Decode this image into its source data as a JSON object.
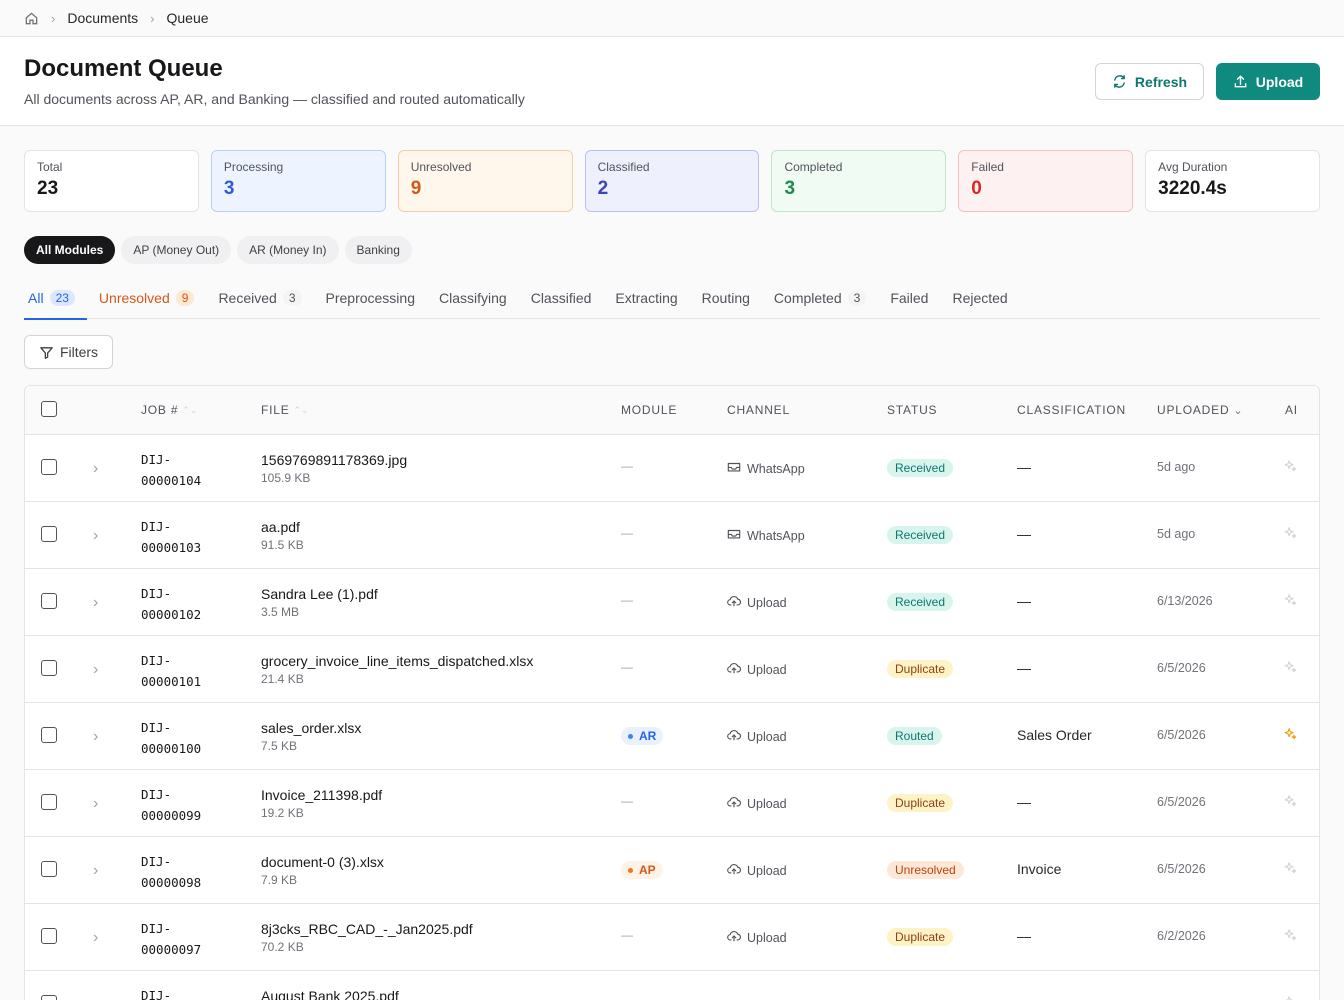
{
  "breadcrumb": {
    "home_icon": "home-icon",
    "items": [
      "Documents",
      "Queue"
    ]
  },
  "header": {
    "title": "Document Queue",
    "subtitle": "All documents across AP, AR, and Banking — classified and routed automatically",
    "refresh_label": "Refresh",
    "upload_label": "Upload"
  },
  "stats": [
    {
      "label": "Total",
      "value": "23"
    },
    {
      "label": "Processing",
      "value": "3"
    },
    {
      "label": "Unresolved",
      "value": "9"
    },
    {
      "label": "Classified",
      "value": "2"
    },
    {
      "label": "Completed",
      "value": "3"
    },
    {
      "label": "Failed",
      "value": "0"
    },
    {
      "label": "Avg Duration",
      "value": "3220.4s"
    }
  ],
  "modules": [
    "All Modules",
    "AP (Money Out)",
    "AR (Money In)",
    "Banking"
  ],
  "tabs": [
    {
      "label": "All",
      "count": "23"
    },
    {
      "label": "Unresolved",
      "count": "9"
    },
    {
      "label": "Received",
      "count": "3"
    },
    {
      "label": "Preprocessing"
    },
    {
      "label": "Classifying"
    },
    {
      "label": "Classified"
    },
    {
      "label": "Extracting"
    },
    {
      "label": "Routing"
    },
    {
      "label": "Completed",
      "count": "3"
    },
    {
      "label": "Failed"
    },
    {
      "label": "Rejected"
    }
  ],
  "filters_label": "Filters",
  "table": {
    "columns": {
      "job": "JOB #",
      "file": "FILE",
      "module": "MODULE",
      "channel": "CHANNEL",
      "status": "STATUS",
      "classification": "CLASSIFICATION",
      "uploaded": "UPLOADED",
      "ai": "AI"
    },
    "rows": [
      {
        "job1": "DIJ-",
        "job2": "00000104",
        "file": "1569769891178369.jpg",
        "size": "105.9 KB",
        "module": "—",
        "channel": "WhatsApp",
        "status": "Received",
        "classification": "—",
        "uploaded": "5d ago"
      },
      {
        "job1": "DIJ-",
        "job2": "00000103",
        "file": "aa.pdf",
        "size": "91.5 KB",
        "module": "—",
        "channel": "WhatsApp",
        "status": "Received",
        "classification": "—",
        "uploaded": "5d ago"
      },
      {
        "job1": "DIJ-",
        "job2": "00000102",
        "file": "Sandra Lee (1).pdf",
        "size": "3.5 MB",
        "module": "—",
        "channel": "Upload",
        "status": "Received",
        "classification": "—",
        "uploaded": "6/13/2026"
      },
      {
        "job1": "DIJ-",
        "job2": "00000101",
        "file": "grocery_invoice_line_items_dispatched.xlsx",
        "size": "21.4 KB",
        "module": "—",
        "channel": "Upload",
        "status": "Duplicate",
        "classification": "—",
        "uploaded": "6/5/2026"
      },
      {
        "job1": "DIJ-",
        "job2": "00000100",
        "file": "sales_order.xlsx",
        "size": "7.5 KB",
        "module": "AR",
        "channel": "Upload",
        "status": "Routed",
        "classification": "Sales Order",
        "uploaded": "6/5/2026"
      },
      {
        "job1": "DIJ-",
        "job2": "00000099",
        "file": "Invoice_211398.pdf",
        "size": "19.2 KB",
        "module": "—",
        "channel": "Upload",
        "status": "Duplicate",
        "classification": "—",
        "uploaded": "6/5/2026"
      },
      {
        "job1": "DIJ-",
        "job2": "00000098",
        "file": "document-0 (3).xlsx",
        "size": "7.9 KB",
        "module": "AP",
        "channel": "Upload",
        "status": "Unresolved",
        "classification": "Invoice",
        "uploaded": "6/5/2026"
      },
      {
        "job1": "DIJ-",
        "job2": "00000097",
        "file": "8j3cks_RBC_CAD_-_Jan2025.pdf",
        "size": "70.2 KB",
        "module": "—",
        "channel": "Upload",
        "status": "Duplicate",
        "classification": "—",
        "uploaded": "6/2/2026"
      },
      {
        "job1": "DIJ-",
        "job2": "",
        "file": "August Bank 2025.pdf",
        "size": "",
        "module": "",
        "channel": "",
        "status": "",
        "classification": "",
        "uploaded": ""
      }
    ]
  }
}
